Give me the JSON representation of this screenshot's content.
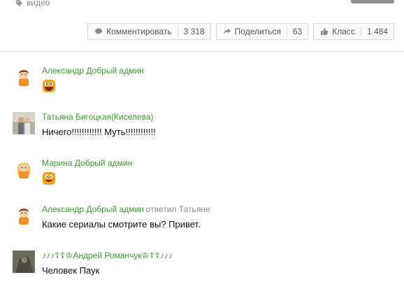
{
  "tag": {
    "label": "видео",
    "icon": "tag-icon"
  },
  "actions": {
    "comment": {
      "label": "Комментировать",
      "count": "3 318",
      "icon": "speech-bubble-icon"
    },
    "share": {
      "label": "Поделиться",
      "count": "63",
      "icon": "share-arrow-icon"
    },
    "like": {
      "label": "Класс",
      "count": "1 484",
      "icon": "thumbs-up-icon"
    }
  },
  "comments": [
    {
      "author": "Александр Добрый админ",
      "reply": "",
      "text": "",
      "emoji": "laughing-smiley-icon"
    },
    {
      "author": "Татьяна Бигоцкая(Киселева)",
      "reply": "",
      "text": "Ничего!!!!!!!!!!!! Муть!!!!!!!!!!!!",
      "emoji": ""
    },
    {
      "author": "Марина Добрый админ",
      "reply": "",
      "text": "",
      "emoji": "grinning-smiley-icon"
    },
    {
      "author": "Александр Добрый админ",
      "reply": "ответил Татьяне",
      "text": "Какие сериалы смотрите вы? Привет.",
      "emoji": ""
    },
    {
      "author": "♪♪♪☦☦♔Андрей Романчук♔☦☦♪♪♪",
      "reply": "",
      "text": "Человек Паук",
      "emoji": ""
    }
  ],
  "colors": {
    "author": "#3c9b2f",
    "muted": "#8a8a8a",
    "divider": "#e2e2e2"
  }
}
